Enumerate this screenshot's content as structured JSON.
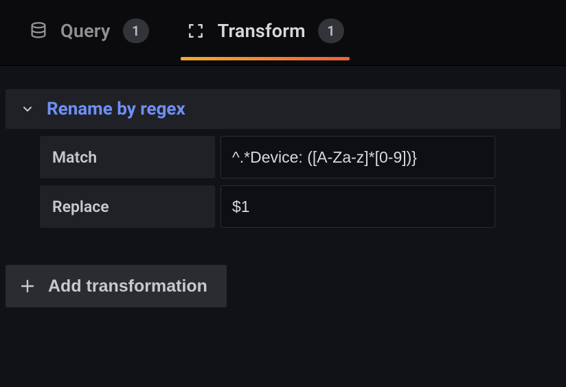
{
  "tabs": {
    "query": {
      "label": "Query",
      "count": "1"
    },
    "transform": {
      "label": "Transform",
      "count": "1"
    }
  },
  "section": {
    "title": "Rename by regex",
    "fields": {
      "match": {
        "label": "Match",
        "value": "^.*Device: ([A-Za-z]*[0-9])}"
      },
      "replace": {
        "label": "Replace",
        "value": "$1"
      }
    }
  },
  "addButton": {
    "label": "Add transformation"
  }
}
